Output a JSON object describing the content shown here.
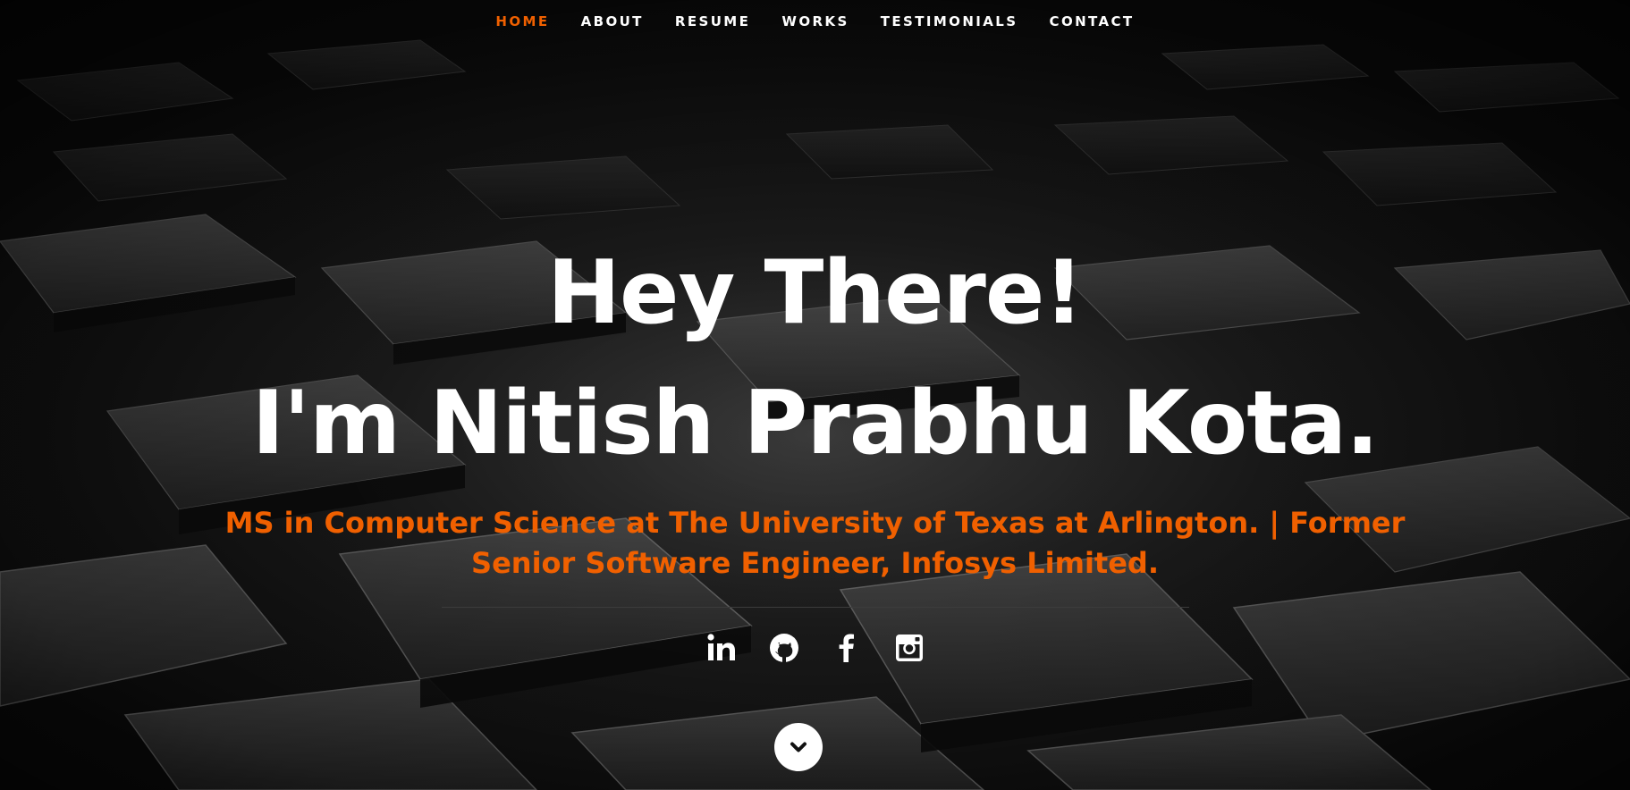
{
  "nav": {
    "items": [
      {
        "label": "HOME",
        "active": true
      },
      {
        "label": "ABOUT",
        "active": false
      },
      {
        "label": "RESUME",
        "active": false
      },
      {
        "label": "WORKS",
        "active": false
      },
      {
        "label": "TESTIMONIALS",
        "active": false
      },
      {
        "label": "CONTACT",
        "active": false
      }
    ]
  },
  "banner": {
    "line1": "Hey There!",
    "line2": "I'm Nitish Prabhu Kota.",
    "subtitle": "MS in Computer Science at The University of Texas at Arlington. | Former Senior Software Engineer, Infosys Limited."
  },
  "social": {
    "icons": [
      "linkedin-icon",
      "github-icon",
      "facebook-icon",
      "instagram-icon"
    ]
  },
  "scroll": {
    "icon": "chevron-down-icon"
  },
  "colors": {
    "accent": "#f06000",
    "text": "#ffffff",
    "background": "#111111"
  }
}
